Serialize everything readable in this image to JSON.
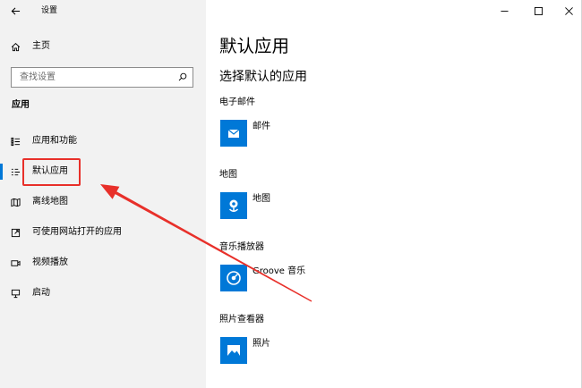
{
  "window": {
    "title": "设置",
    "back_icon": "back-arrow-icon",
    "control_icons": [
      "minimize-icon",
      "maximize-icon",
      "close-icon"
    ]
  },
  "sidebar": {
    "home": {
      "label": "主页",
      "icon": "home-icon"
    },
    "search": {
      "placeholder": "查找设置",
      "icon": "search-icon"
    },
    "section_title": "应用",
    "items": [
      {
        "label": "应用和功能",
        "icon": "apps-features-icon",
        "selected": false
      },
      {
        "label": "默认应用",
        "icon": "default-apps-icon",
        "selected": true
      },
      {
        "label": "离线地图",
        "icon": "offline-maps-icon",
        "selected": false
      },
      {
        "label": "可使用网站打开的应用",
        "icon": "apps-for-websites-icon",
        "selected": false
      },
      {
        "label": "视频播放",
        "icon": "video-playback-icon",
        "selected": false
      },
      {
        "label": "启动",
        "icon": "startup-icon",
        "selected": false
      }
    ]
  },
  "main": {
    "title": "默认应用",
    "subtitle": "选择默认的应用",
    "categories": [
      {
        "heading": "电子邮件",
        "app_name": "邮件",
        "app_icon": "mail-icon"
      },
      {
        "heading": "地图",
        "app_name": "地图",
        "app_icon": "maps-icon"
      },
      {
        "heading": "音乐播放器",
        "app_name": "Groove 音乐",
        "app_icon": "groove-music-icon"
      },
      {
        "heading": "照片查看器",
        "app_name": "照片",
        "app_icon": "photos-icon"
      }
    ]
  },
  "colors": {
    "accent": "#0078d7",
    "sidebar_background": "#f2f2f2",
    "annotation_red": "#e8302a",
    "text": "#000000",
    "search_border": "#8c8c8c",
    "placeholder": "#6b6b6b"
  }
}
